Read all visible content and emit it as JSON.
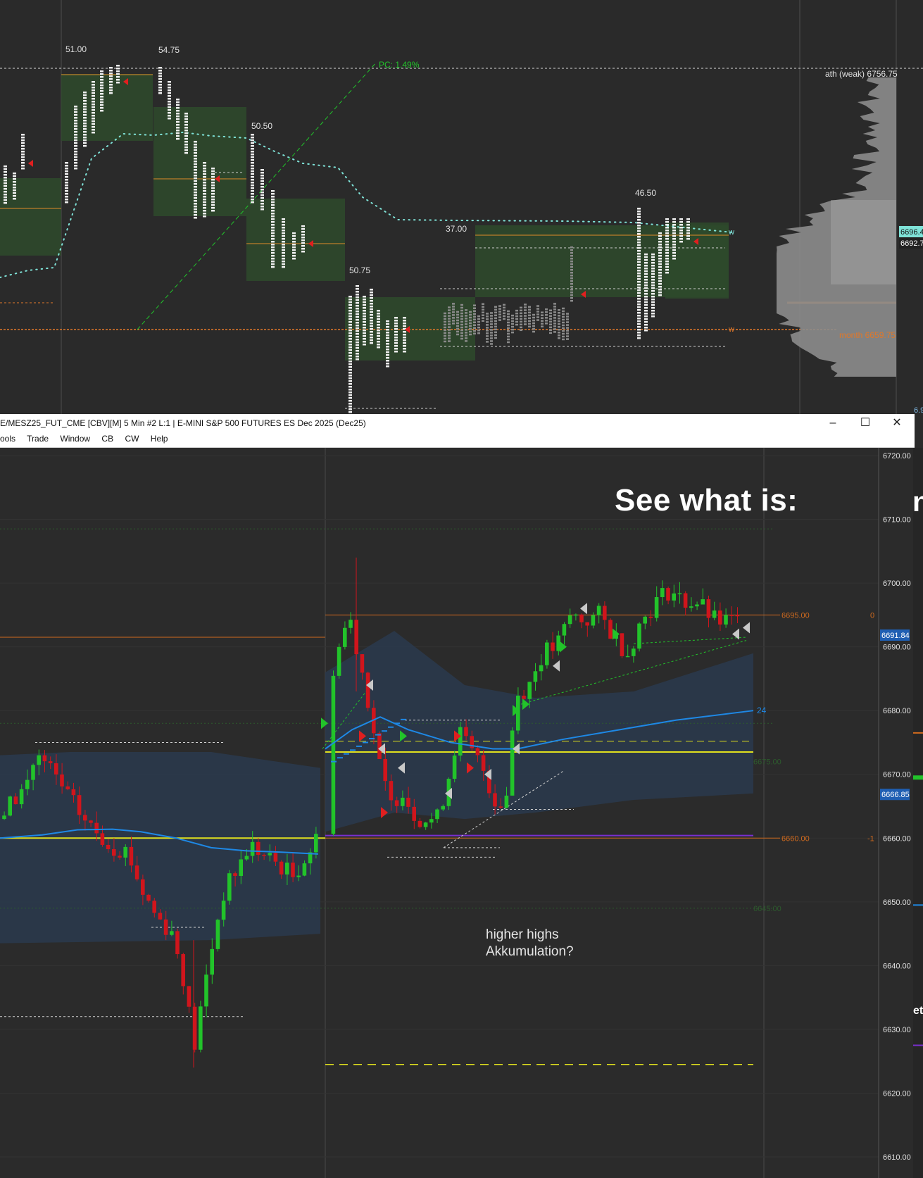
{
  "top_chart": {
    "profile_labels": [
      "51.00",
      "54.75",
      "50.50",
      "46.50",
      "37.00",
      "50.75"
    ],
    "pc_label": "PC: 1.49%",
    "ath_label": "ath (weak)  6756.75",
    "month_label": "month  6659.75",
    "price_tags": [
      "6696.4",
      "6692.7"
    ],
    "w_marks": [
      "w",
      "w"
    ],
    "bottom_tag": "6.9"
  },
  "window": {
    "title": "E/MESZ25_FUT_CME [CBV][M]  5 Min  #2 L:1 | E-MINI S&P 500 FUTURES ES Dec 2025 (Dec25)",
    "minimize": "–",
    "maximize": "☐",
    "close": "✕",
    "menu": [
      "ools",
      "Trade",
      "Window",
      "CB",
      "CW",
      "Help"
    ]
  },
  "bottom_chart": {
    "overlay_title": "See what is:",
    "note_line1": "higher highs",
    "note_line2": "Akkumulation?",
    "level_labels": [
      "6695.00",
      "6660.00",
      "6675.00",
      "6645.00"
    ],
    "side_numbers": [
      "0",
      "-1"
    ],
    "vwap_count": "24",
    "price_badges": [
      "6691.84",
      "6666.85"
    ],
    "edge_letters": [
      "n",
      "et"
    ],
    "colors": {
      "up": "#22c32a",
      "down": "#d0151c",
      "vwap": "#1e88e5",
      "level": "#e0e01e",
      "band": "#2a3a4d"
    }
  },
  "chart_data": {
    "type": "candlestick",
    "title": "",
    "symbol": "MESZ25_FUT_CME",
    "timeframe": "5 Min",
    "y_axis_ticks": [
      6720,
      6710,
      6700,
      6690,
      6680,
      6670,
      6660,
      6650,
      6640,
      6630,
      6620,
      6610
    ],
    "ylim": [
      6607,
      6722
    ],
    "levels": [
      {
        "label": "6695.00",
        "value": 6695.0
      },
      {
        "label": "6660.00",
        "value": 6660.0
      },
      {
        "label": "6675.00",
        "value": 6673.5
      },
      {
        "label": "6645.00",
        "value": 6649.0
      }
    ],
    "current_price": 6691.84,
    "vwap_value": 6666.85,
    "notes": [
      "higher highs",
      "Akkumulation?"
    ]
  }
}
